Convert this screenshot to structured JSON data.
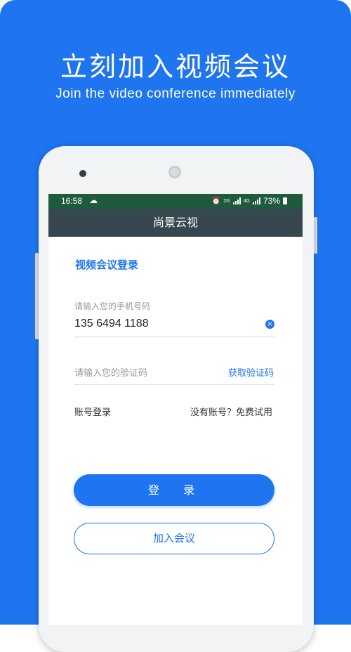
{
  "promo": {
    "headline": "立刻加入视频会议",
    "subheadline": "Join the video conference immediately"
  },
  "status_bar": {
    "time": "16:58",
    "weather_icon": "☁",
    "alarm_icon": "⏰",
    "network_2g": "2G",
    "network_4g": "4G",
    "battery": "73%"
  },
  "app_bar": {
    "title": "尚景云视"
  },
  "login": {
    "title": "视频会议登录",
    "phone_label": "请输入您的手机号码",
    "phone_value": "135 6494 1188",
    "clear_icon": "×",
    "code_placeholder": "请输入您的验证码",
    "get_code": "获取验证码",
    "account_login": "账号登录",
    "no_account": "没有账号？免费试用",
    "login_button": "登  录",
    "join_button": "加入会议"
  },
  "colors": {
    "brand": "#1f75f0",
    "status_bar": "#1e5b3c",
    "app_bar": "#37474f"
  }
}
